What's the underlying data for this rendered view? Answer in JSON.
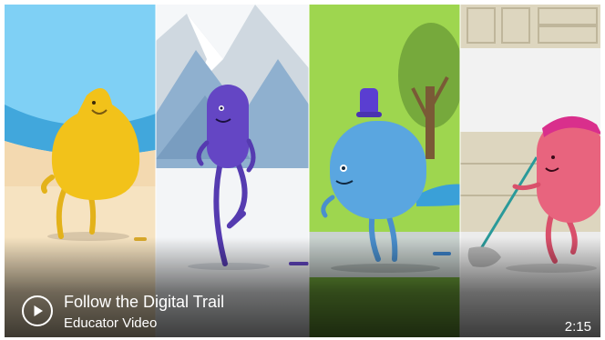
{
  "video": {
    "title": "Follow the Digital Trail",
    "subtitle": "Educator Video",
    "duration": "2:15"
  },
  "icons": {
    "play": "play-icon"
  },
  "colors": {
    "yellow_character": "#f2c21a",
    "purple_character": "#6446c4",
    "blue_character": "#5aa6e0",
    "pink_character": "#e8647e",
    "overlay_text": "#ffffff"
  }
}
